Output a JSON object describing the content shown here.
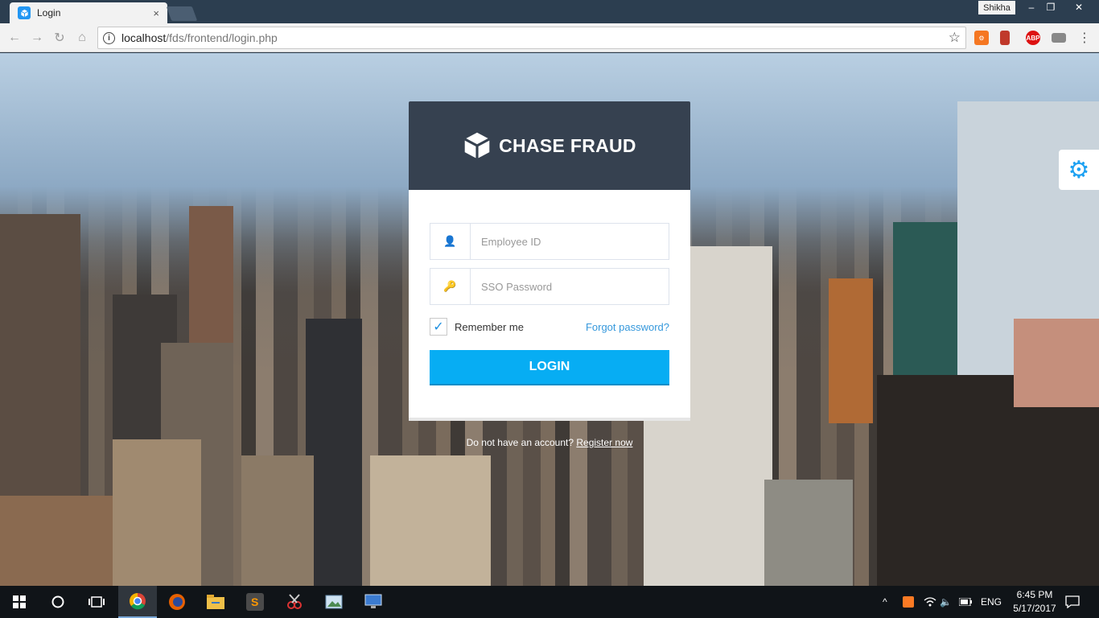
{
  "browser": {
    "tab_title": "Login",
    "tab_close": "×",
    "profile_name": "Shikha",
    "url_host": "localhost",
    "url_path": "/fds/frontend/login.php",
    "window_controls": [
      "–",
      "❐",
      "✕"
    ],
    "extensions": [
      "hubspot-extension-icon",
      "bookmark-extension-icon",
      "adblock-plus-icon",
      "cast-icon"
    ],
    "abp_label": "ABP"
  },
  "login": {
    "brand_name": "CHASE FRAUD",
    "employee_placeholder": "Employee ID",
    "password_placeholder": "SSO Password",
    "remember_label": "Remember me",
    "remember_checked": true,
    "forgot_label": "Forgot password?",
    "login_button": "LOGIN",
    "register_prompt": "Do not have an account?",
    "register_link": "Register now"
  },
  "colors": {
    "header_bg": "#364150",
    "primary_button": "#07adf3",
    "link": "#3598dc"
  },
  "taskbar": {
    "apps": [
      "windows-start-icon",
      "cortana-icon",
      "task-view-icon",
      "chrome-icon",
      "firefox-icon",
      "file-explorer-icon",
      "sublime-text-icon",
      "snipping-tool-icon",
      "photos-icon",
      "remote-desktop-icon"
    ],
    "language": "ENG",
    "time": "6:45 PM",
    "date": "5/17/2017"
  }
}
